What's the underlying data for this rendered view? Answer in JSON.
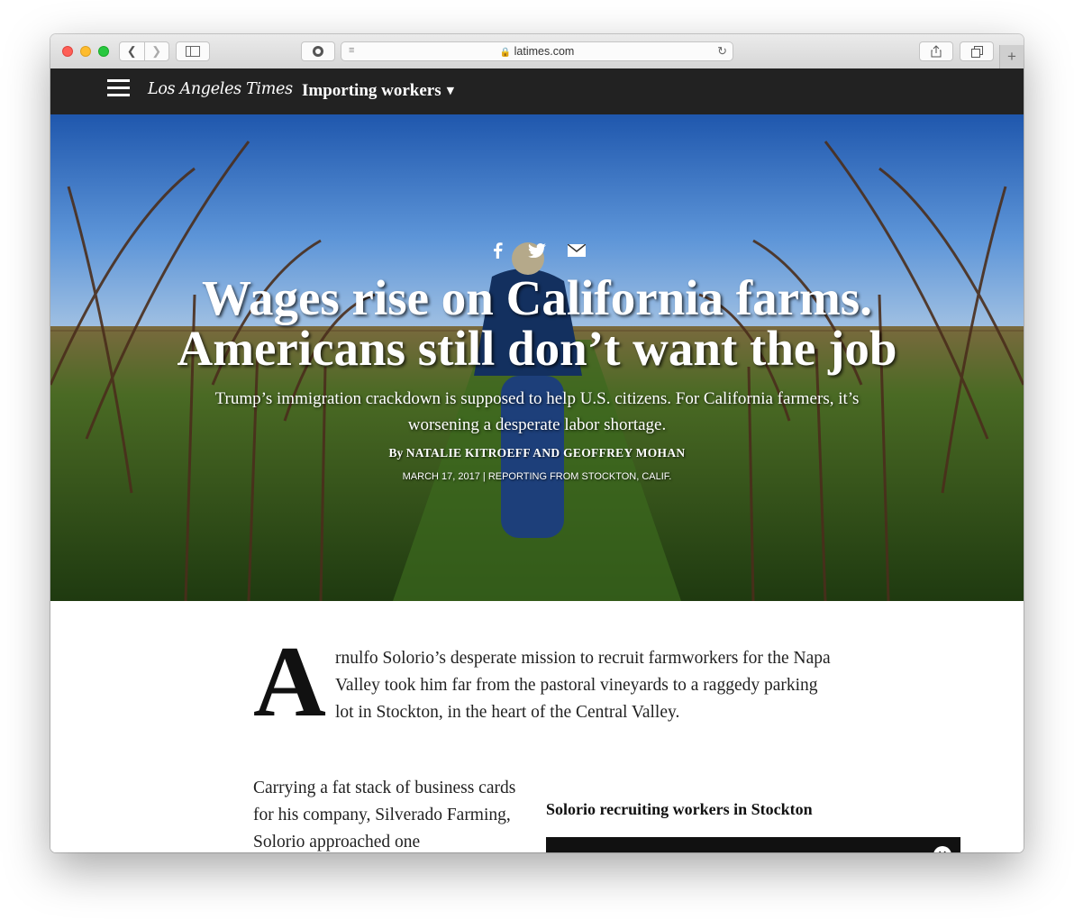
{
  "browser": {
    "url": "latimes.com",
    "icons": {
      "back": "chevron-left-icon",
      "forward": "chevron-right-icon",
      "sidebar": "sidebar-icon",
      "privacy": "privacy-shield-icon",
      "reader": "reader-icon",
      "lock": "lock-icon",
      "reload": "reload-icon",
      "share": "share-icon",
      "tabs": "tabs-icon",
      "new_tab": "plus-icon"
    }
  },
  "site": {
    "logo": "Los Angeles Times",
    "section": "Importing workers"
  },
  "hero": {
    "headline_line1": "Wages rise on California farms.",
    "headline_line2": "Americans still don’t want the job",
    "dek": "Trump’s immigration crackdown is supposed to help U.S. citizens. For California farmers, it’s worsening a desperate labor shortage.",
    "byline_prefix": "By ",
    "byline_names": "NATALIE KITROEFF AND GEOFFREY MOHAN",
    "dateline": "MARCH 17, 2017 | REPORTING FROM STOCKTON, CALIF.",
    "share_icons": [
      "facebook-icon",
      "twitter-icon",
      "email-icon"
    ]
  },
  "article": {
    "dropcap": "A",
    "lead": "rnulfo Solorio’s desperate mission to recruit farmworkers for the Napa Valley took him far from the pastoral vineyards to a raggedy parking lot in Stockton, in the heart of the Central Valley.",
    "para2": "Carrying a fat stack of business cards for his company, Silverado Farming, Solorio approached one",
    "video_caption": "Solorio recruiting workers in Stockton"
  }
}
